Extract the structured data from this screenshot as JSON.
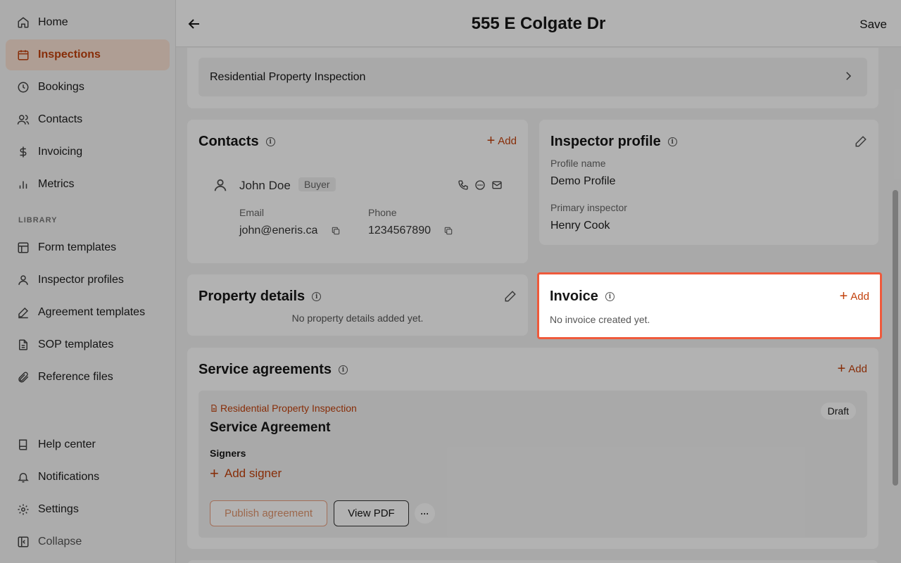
{
  "sidebar": {
    "items": [
      {
        "label": "Home",
        "icon": "home-icon"
      },
      {
        "label": "Inspections",
        "icon": "calendar-icon"
      },
      {
        "label": "Bookings",
        "icon": "clock-icon"
      },
      {
        "label": "Contacts",
        "icon": "users-icon"
      },
      {
        "label": "Invoicing",
        "icon": "dollar-icon"
      },
      {
        "label": "Metrics",
        "icon": "bar-chart-icon"
      }
    ],
    "library_label": "LIBRARY",
    "library_items": [
      {
        "label": "Form templates",
        "icon": "layout-icon"
      },
      {
        "label": "Inspector profiles",
        "icon": "user-icon"
      },
      {
        "label": "Agreement templates",
        "icon": "signature-icon"
      },
      {
        "label": "SOP templates",
        "icon": "file-icon"
      },
      {
        "label": "Reference files",
        "icon": "paperclip-icon"
      }
    ],
    "bottom_items": [
      {
        "label": "Help center",
        "icon": "book-icon"
      },
      {
        "label": "Notifications",
        "icon": "bell-icon"
      },
      {
        "label": "Settings",
        "icon": "gear-icon"
      },
      {
        "label": "Collapse",
        "icon": "sidebar-collapse-icon"
      }
    ]
  },
  "header": {
    "title": "555 E Colgate Dr",
    "save": "Save"
  },
  "template_card": {
    "label": "Residential Property Inspection"
  },
  "contacts": {
    "title": "Contacts",
    "add": "Add",
    "contact": {
      "name": "John Doe",
      "role": "Buyer",
      "email_label": "Email",
      "email": "john@eneris.ca",
      "phone_label": "Phone",
      "phone": "1234567890"
    }
  },
  "inspector_profile": {
    "title": "Inspector profile",
    "profile_name_label": "Profile name",
    "profile_name": "Demo Profile",
    "primary_label": "Primary inspector",
    "primary": "Henry Cook"
  },
  "property_details": {
    "title": "Property details",
    "empty": "No property details added yet."
  },
  "invoice": {
    "title": "Invoice",
    "add": "Add",
    "empty": "No invoice created yet."
  },
  "service_agreements": {
    "title": "Service agreements",
    "add": "Add",
    "agreement": {
      "template": "Residential Property Inspection",
      "title": "Service Agreement",
      "status": "Draft",
      "signers_label": "Signers",
      "add_signer": "Add signer",
      "publish": "Publish agreement",
      "view_pdf": "View PDF",
      "more": "···"
    }
  },
  "colors": {
    "accent": "#c2410c",
    "highlight_border": "#ef5a3c",
    "active_bg": "#fbe3d4"
  }
}
